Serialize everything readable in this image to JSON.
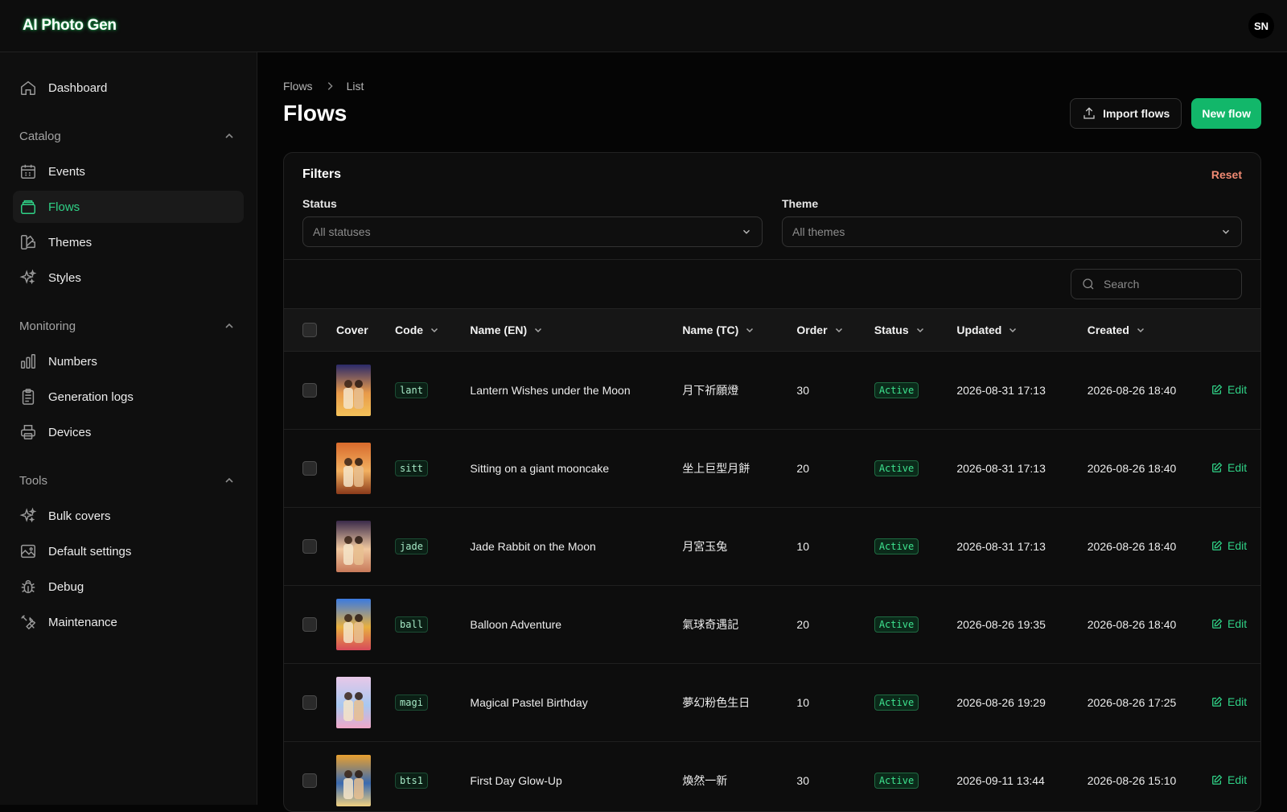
{
  "app": {
    "title": "AI Photo Gen",
    "user_initials": "SN"
  },
  "sidebar": {
    "dashboard": "Dashboard",
    "sections": [
      {
        "label": "Catalog",
        "items": [
          {
            "label": "Events"
          },
          {
            "label": "Flows"
          },
          {
            "label": "Themes"
          },
          {
            "label": "Styles"
          }
        ]
      },
      {
        "label": "Monitoring",
        "items": [
          {
            "label": "Numbers"
          },
          {
            "label": "Generation logs"
          },
          {
            "label": "Devices"
          }
        ]
      },
      {
        "label": "Tools",
        "items": [
          {
            "label": "Bulk covers"
          },
          {
            "label": "Default settings"
          },
          {
            "label": "Debug"
          },
          {
            "label": "Maintenance"
          }
        ]
      }
    ],
    "active_item": "Flows"
  },
  "breadcrumb": {
    "root": "Flows",
    "current": "List"
  },
  "page": {
    "title": "Flows",
    "import_label": "Import flows",
    "new_label": "New flow"
  },
  "filters": {
    "title": "Filters",
    "reset_label": "Reset",
    "status": {
      "label": "Status",
      "value": "All statuses"
    },
    "theme": {
      "label": "Theme",
      "value": "All themes"
    }
  },
  "search": {
    "placeholder": "Search"
  },
  "table": {
    "columns": {
      "cover": "Cover",
      "code": "Code",
      "name_en": "Name (EN)",
      "name_tc": "Name (TC)",
      "order": "Order",
      "status": "Status",
      "updated": "Updated",
      "created": "Created"
    },
    "edit_label": "Edit",
    "rows": [
      {
        "code": "lant",
        "name_en": "Lantern Wishes under the Moon",
        "name_tc": "月下祈願燈",
        "order": "30",
        "status": "Active",
        "updated": "2026-08-31 17:13",
        "created": "2026-08-26 18:40"
      },
      {
        "code": "sitt",
        "name_en": "Sitting on a giant mooncake",
        "name_tc": "坐上巨型月餅",
        "order": "20",
        "status": "Active",
        "updated": "2026-08-31 17:13",
        "created": "2026-08-26 18:40"
      },
      {
        "code": "jade",
        "name_en": "Jade Rabbit on the Moon",
        "name_tc": "月宮玉兔",
        "order": "10",
        "status": "Active",
        "updated": "2026-08-31 17:13",
        "created": "2026-08-26 18:40"
      },
      {
        "code": "ball",
        "name_en": "Balloon Adventure",
        "name_tc": "氣球奇遇記",
        "order": "20",
        "status": "Active",
        "updated": "2026-08-26 19:35",
        "created": "2026-08-26 18:40"
      },
      {
        "code": "magi",
        "name_en": "Magical Pastel Birthday",
        "name_tc": "夢幻粉色生日",
        "order": "10",
        "status": "Active",
        "updated": "2026-08-26 19:29",
        "created": "2026-08-26 17:25"
      },
      {
        "code": "bts1",
        "name_en": "First Day Glow-Up",
        "name_tc": "煥然一新",
        "order": "30",
        "status": "Active",
        "updated": "2026-09-11 13:44",
        "created": "2026-08-26 15:10"
      }
    ]
  },
  "colors": {
    "accent": "#12b76a",
    "accent_text": "#2fd186",
    "reset": "#f08a73",
    "brand_glow": "#22c55e"
  }
}
